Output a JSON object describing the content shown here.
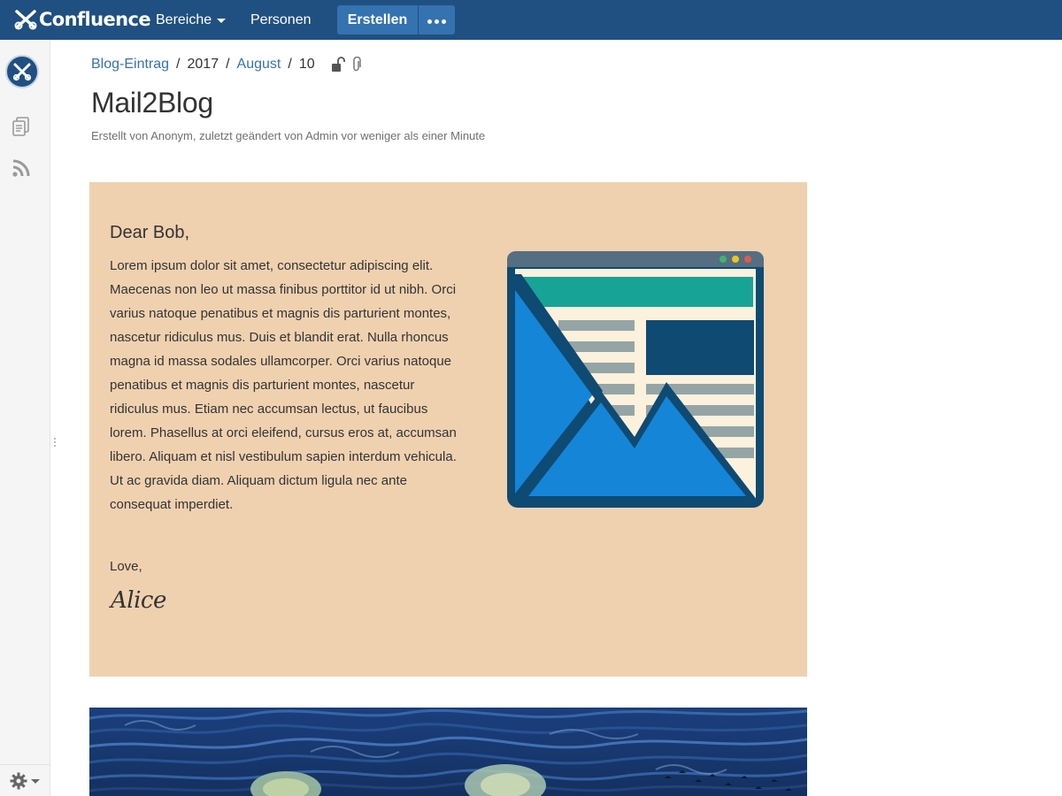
{
  "app": {
    "name": "Confluence"
  },
  "nav": {
    "spaces_label": "Bereiche",
    "people_label": "Personen",
    "create_label": "Erstellen"
  },
  "breadcrumbs": {
    "items": [
      "Blog-Eintrag",
      "2017",
      "August",
      "10"
    ]
  },
  "page": {
    "title": "Mail2Blog",
    "meta": "Erstellt von Anonym, zuletzt geändert von Admin vor weniger als einer Minute"
  },
  "letter": {
    "salutation": "Dear Bob,",
    "body": "Lorem ipsum dolor sit amet, consectetur adipiscing elit. Maecenas non leo ut massa finibus porttitor id ut nibh. Orci varius natoque penatibus et magnis dis parturient montes, nascetur ridiculus mus. Duis et blandit erat. Nulla rhoncus magna id massa sodales ullamcorper. Orci varius natoque penatibus et magnis dis parturient montes, nascetur ridiculus mus. Etiam nec accumsan lectus, ut faucibus lorem. Phasellus at orci eleifend, cursus eros at, accumsan libero. Aliquam et nisl vestibulum sapien interdum vehicula. Ut ac gravida diam. Aliquam dictum ligula nec ante consequat imperdiet.",
    "closing": "Love,",
    "signature": "Alice",
    "background_color": "#efd1b0"
  },
  "colors": {
    "topbar": "#205081",
    "button": "#3572b0",
    "link": "#3572b0"
  },
  "icons": {
    "logo": "confluence-logo-icon",
    "more": "more-dots-icon",
    "restrictions": "unlock-icon",
    "attachments": "paperclip-icon",
    "pages": "pages-icon",
    "blog": "rss-icon",
    "settings": "gear-icon"
  }
}
